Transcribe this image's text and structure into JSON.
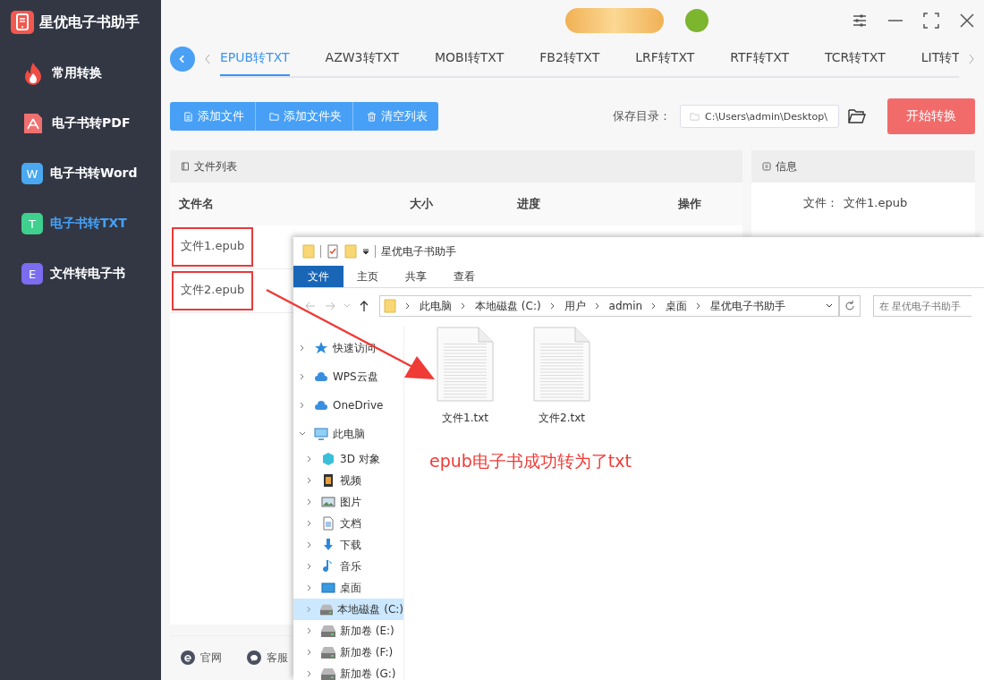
{
  "app": {
    "title": "星优电子书助手"
  },
  "sidebar": {
    "items": [
      {
        "label": "常用转换",
        "kind": "fire",
        "selected": false
      },
      {
        "label": "电子书转PDF",
        "kind": "pdf",
        "selected": false
      },
      {
        "label": "电子书转Word",
        "kind": "letter",
        "badge": "W",
        "color": "#4aa8f0",
        "selected": false
      },
      {
        "label": "电子书转TXT",
        "kind": "letter",
        "badge": "T",
        "color": "#3fcf8e",
        "selected": true
      },
      {
        "label": "文件转电子书",
        "kind": "letter",
        "badge": "E",
        "color": "#7b6cf0",
        "selected": false
      }
    ]
  },
  "tabs": [
    {
      "label": "EPUB转TXT",
      "selected": true
    },
    {
      "label": "AZW3转TXT",
      "selected": false
    },
    {
      "label": "MOBI转TXT",
      "selected": false
    },
    {
      "label": "FB2转TXT",
      "selected": false
    },
    {
      "label": "LRF转TXT",
      "selected": false
    },
    {
      "label": "RTF转TXT",
      "selected": false
    },
    {
      "label": "TCR转TXT",
      "selected": false
    },
    {
      "label": "LIT转T",
      "selected": false
    }
  ],
  "toolbar": [
    {
      "label": "添加文件",
      "kind": "file"
    },
    {
      "label": "添加文件夹",
      "kind": "folder"
    },
    {
      "label": "清空列表",
      "kind": "trash"
    }
  ],
  "save": {
    "label": "保存目录：",
    "path": "C:\\Users\\admin\\Desktop\\"
  },
  "start_button": "开始转换",
  "file_list": {
    "title": "文件列表",
    "columns": [
      "文件名",
      "大小",
      "进度",
      "操作"
    ],
    "rows": [
      {
        "name": "文件1.epub",
        "marked": true
      },
      {
        "name": "文件2.epub",
        "marked": true
      }
    ]
  },
  "info": {
    "title": "信息",
    "fields": [
      {
        "label": "文件：",
        "value": "文件1.epub"
      }
    ]
  },
  "footer": [
    {
      "label": "官网",
      "kind": "web"
    },
    {
      "label": "客服",
      "kind": "chat"
    }
  ],
  "explorer": {
    "title": "星优电子书助手",
    "ribbon_tabs": [
      {
        "label": "文件",
        "selected": true
      },
      {
        "label": "主页",
        "selected": false
      },
      {
        "label": "共享",
        "selected": false
      },
      {
        "label": "查看",
        "selected": false
      }
    ],
    "breadcrumb": [
      "此电脑",
      "本地磁盘 (C:)",
      "用户",
      "admin",
      "桌面",
      "星优电子书助手"
    ],
    "search": {
      "placeholder": "在 星优电子书助手"
    },
    "nav": [
      {
        "label": "快速访问",
        "kind": "star",
        "expanded": false,
        "selected": false
      },
      {
        "label": "WPS云盘",
        "kind": "cloud",
        "expanded": false,
        "selected": false
      },
      {
        "label": "OneDrive",
        "kind": "cloud",
        "expanded": false,
        "selected": false
      },
      {
        "label": "此电脑",
        "kind": "pc",
        "expanded": true,
        "selected": false,
        "children": [
          {
            "label": "3D 对象",
            "kind": "cube",
            "expanded": false,
            "selected": false
          },
          {
            "label": "视频",
            "kind": "film",
            "expanded": false,
            "selected": false
          },
          {
            "label": "图片",
            "kind": "image",
            "expanded": false,
            "selected": false
          },
          {
            "label": "文档",
            "kind": "doc",
            "expanded": false,
            "selected": false
          },
          {
            "label": "下载",
            "kind": "download",
            "expanded": false,
            "selected": false
          },
          {
            "label": "音乐",
            "kind": "music",
            "expanded": false,
            "selected": false
          },
          {
            "label": "桌面",
            "kind": "desktop",
            "expanded": false,
            "selected": false
          },
          {
            "label": "本地磁盘 (C:)",
            "kind": "drive",
            "expanded": false,
            "selected": true
          },
          {
            "label": "新加卷 (E:)",
            "kind": "drive",
            "expanded": false,
            "selected": false
          },
          {
            "label": "新加卷 (F:)",
            "kind": "drive",
            "expanded": false,
            "selected": false
          },
          {
            "label": "新加卷 (G:)",
            "kind": "drive",
            "expanded": false,
            "selected": false
          }
        ]
      }
    ],
    "files": [
      "文件1.txt",
      "文件2.txt"
    ]
  },
  "annotation": {
    "text": "epub电子书成功转为了txt"
  }
}
